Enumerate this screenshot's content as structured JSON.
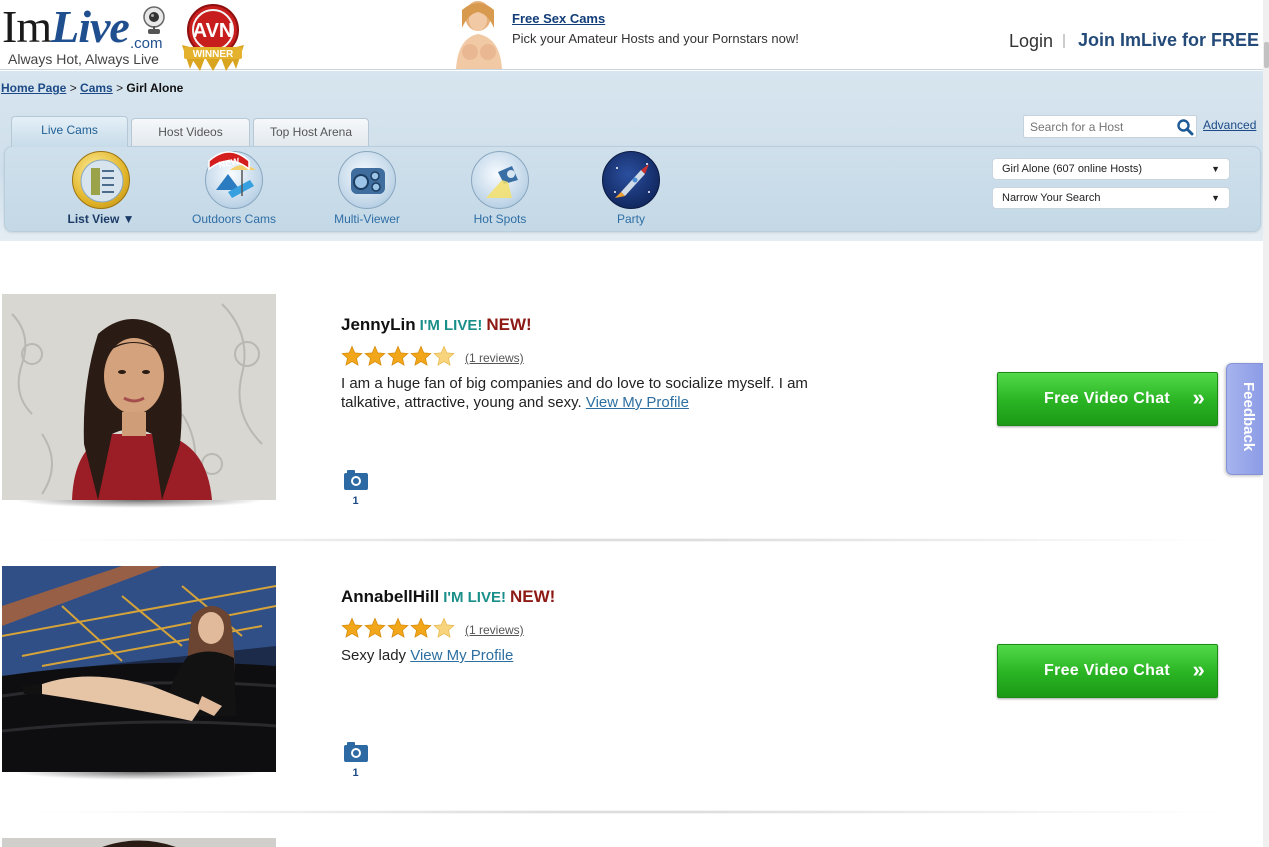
{
  "header": {
    "logo": {
      "im": "Im",
      "live": "Live",
      "com": ".com",
      "tagline": "Always Hot, Always Live"
    },
    "badge": {
      "text": "AVN",
      "sub": "WINNER"
    },
    "promo": {
      "link": "Free Sex Cams",
      "subtitle": "Pick your Amateur Hosts and your Pornstars now!"
    },
    "login": "Login",
    "join": "Join ImLive for FREE"
  },
  "breadcrumb": {
    "home": "Home Page",
    "sep1": " > ",
    "cams": "Cams",
    "sep2": " > ",
    "current": "Girl Alone"
  },
  "tabs": [
    {
      "label": "Live Cams",
      "active": true
    },
    {
      "label": "Host Videos",
      "active": false
    },
    {
      "label": "Top Host Arena",
      "active": false
    }
  ],
  "search": {
    "placeholder": "Search for a Host",
    "advanced": "Advanced"
  },
  "views": [
    {
      "label": "List View ▼",
      "icon": "list-view-icon"
    },
    {
      "label": "Outdoors Cams",
      "icon": "outdoors-icon",
      "badge": "NEW"
    },
    {
      "label": "Multi-Viewer",
      "icon": "multi-viewer-icon"
    },
    {
      "label": "Hot Spots",
      "icon": "spotlight-icon"
    },
    {
      "label": "Party",
      "icon": "rocket-icon"
    }
  ],
  "filters": {
    "category": "Girl Alone  (607 online Hosts)",
    "narrow": "Narrow Your Search"
  },
  "hosts": [
    {
      "name": "JennyLin",
      "live": "I'M LIVE!",
      "new": "NEW!",
      "rating": 4.5,
      "reviews": "(1 reviews)",
      "bio": "I am a huge fan of big companies and do love to socialize myself. I am talkative, attractive, young and sexy.",
      "profile_link": "View My Profile",
      "photos": "1",
      "chat_button": "Free Video Chat",
      "chat_arrow": "»"
    },
    {
      "name": "AnnabellHill",
      "live": "I'M LIVE!",
      "new": "NEW!",
      "rating": 4.5,
      "reviews": "(1 reviews)",
      "bio": "Sexy lady",
      "profile_link": "View My Profile",
      "photos": "1",
      "chat_button": "Free Video Chat",
      "chat_arrow": "»"
    }
  ],
  "feedback": "Feedback",
  "colors": {
    "brand_blue": "#1f4f8f",
    "live_teal": "#1a8f8a",
    "new_red": "#8e1a16",
    "chat_green": "#29b323",
    "feedback": "#97a6ea"
  }
}
